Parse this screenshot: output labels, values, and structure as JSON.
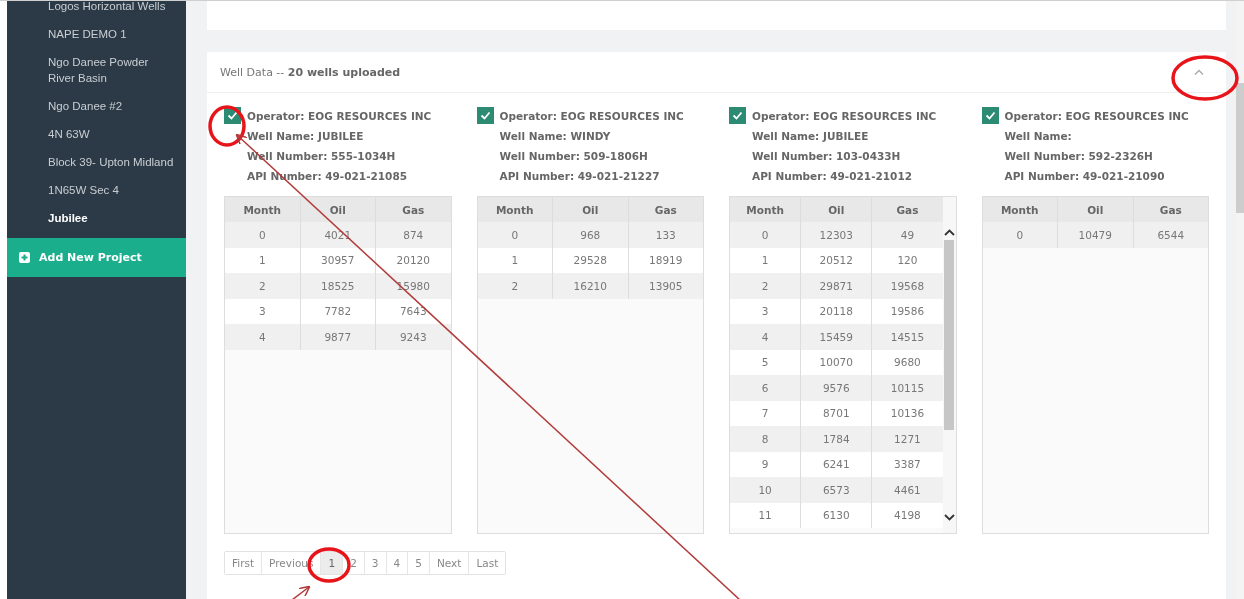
{
  "sidebar": {
    "items": [
      {
        "label": "Logos Horizontal Wells",
        "selected": false
      },
      {
        "label": "NAPE DEMO 1",
        "selected": false
      },
      {
        "label": "Ngo Danee Powder River Basin",
        "selected": false
      },
      {
        "label": "Ngo Danee #2",
        "selected": false
      },
      {
        "label": "4N 63W",
        "selected": false
      },
      {
        "label": "Block 39- Upton Midland",
        "selected": false
      },
      {
        "label": "1N65W Sec 4",
        "selected": false
      },
      {
        "label": "Jubilee",
        "selected": true
      }
    ],
    "add_button": "Add New Project"
  },
  "well_data": {
    "title": "Well Data -- **20 wells uploaded**",
    "expanded": true,
    "wells": [
      {
        "checked": true,
        "columns": [
          "Month",
          "Oil",
          "Gas"
        ],
        "operator": "Operator: EOG RESOURCES INC",
        "well_name": "Well Name: JUBILEE",
        "well_number": "Well Number: 555-1034H",
        "api_number": "API Number: 49-021-21085",
        "rows": [
          [
            "0",
            "4021",
            "874"
          ],
          [
            "1",
            "30957",
            "20120"
          ],
          [
            "2",
            "18525",
            "15980"
          ],
          [
            "3",
            "7782",
            "7643"
          ],
          [
            "4",
            "9877",
            "9243"
          ]
        ]
      },
      {
        "checked": true,
        "columns": [
          "Month",
          "Oil",
          "Gas"
        ],
        "operator": "Operator: EOG RESOURCES INC",
        "well_name": "Well Name: WINDY",
        "well_number": "Well Number: 509-1806H",
        "api_number": "API Number: 49-021-21227",
        "rows": [
          [
            "0",
            "968",
            "133"
          ],
          [
            "1",
            "29528",
            "18919"
          ],
          [
            "2",
            "16210",
            "13905"
          ]
        ]
      },
      {
        "checked": true,
        "columns": [
          "Month",
          "Oil",
          "Gas"
        ],
        "operator": "Operator: EOG RESOURCES INC",
        "well_name": "Well Name: JUBILEE",
        "well_number": "Well Number: 103-0433H",
        "api_number": "API Number: 49-021-21012",
        "rows": [
          [
            "0",
            "12303",
            "49"
          ],
          [
            "1",
            "20512",
            "120"
          ],
          [
            "2",
            "29871",
            "19568"
          ],
          [
            "3",
            "20118",
            "19586"
          ],
          [
            "4",
            "15459",
            "14515"
          ],
          [
            "5",
            "10070",
            "9680"
          ],
          [
            "6",
            "9576",
            "10115"
          ],
          [
            "7",
            "8701",
            "10136"
          ],
          [
            "8",
            "1784",
            "1271"
          ],
          [
            "9",
            "6241",
            "3387"
          ],
          [
            "10",
            "6573",
            "4461"
          ],
          [
            "11",
            "6130",
            "4198"
          ]
        ]
      },
      {
        "checked": true,
        "columns": [
          "Month",
          "Oil",
          "Gas"
        ],
        "operator": "Operator: EOG RESOURCES INC",
        "well_name": "Well Name:",
        "well_number": "Well Number: 592-2326H",
        "api_number": "API Number: 49-021-21090",
        "rows": [
          [
            "0",
            "10479",
            "6544"
          ]
        ]
      }
    ],
    "pagination": [
      {
        "label": "First",
        "selected": false
      },
      {
        "label": "Previous",
        "selected": false
      },
      {
        "label": "1",
        "selected": true
      },
      {
        "label": "2",
        "selected": false
      },
      {
        "label": "3",
        "selected": false
      },
      {
        "label": "4",
        "selected": false
      },
      {
        "label": "5",
        "selected": false
      },
      {
        "label": "Next",
        "selected": false
      },
      {
        "label": "Last",
        "selected": false
      }
    ]
  }
}
